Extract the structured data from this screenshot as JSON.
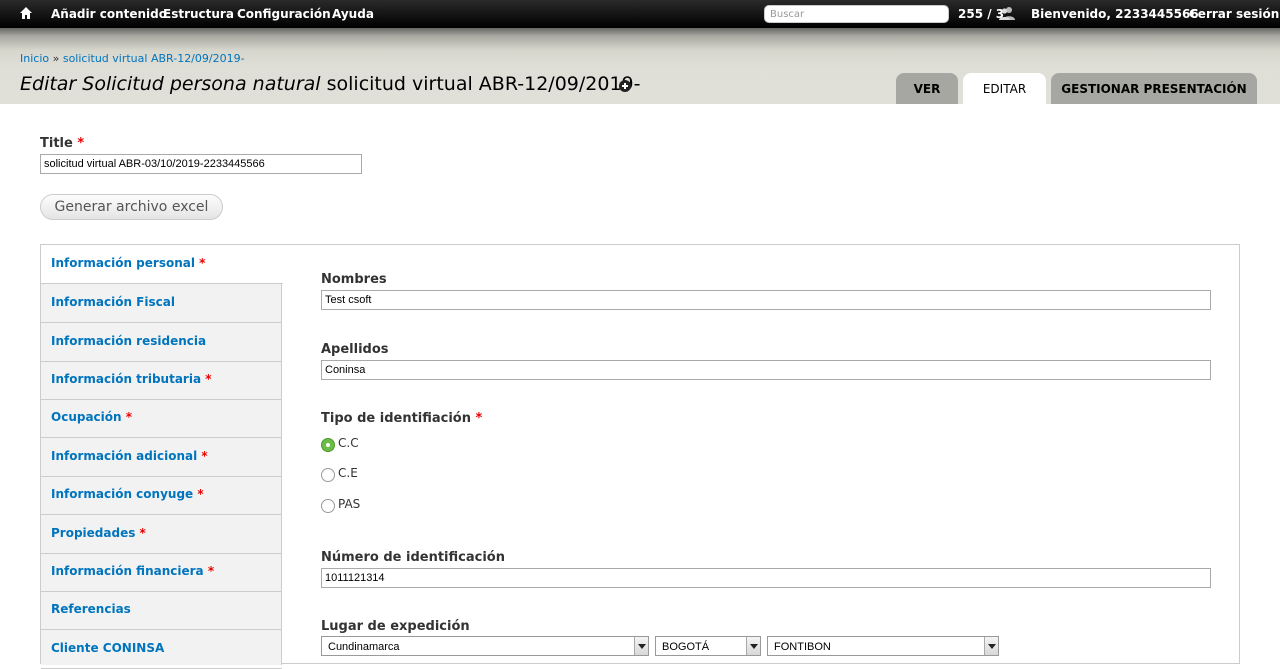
{
  "toolbar": {
    "menu": [
      "Añadir contenido",
      "Estructura",
      "Configuración",
      "Ayuda"
    ],
    "search_placeholder": "Buscar",
    "users_count": "255 / 3",
    "welcome_prefix": "Bienvenido, ",
    "username": "2233445566",
    "logout": "Cerrar sesión"
  },
  "breadcrumb": {
    "home": "Inicio",
    "separator": " » ",
    "current": "solicitud virtual ABR-12/09/2019-"
  },
  "page_title": {
    "italic": "Editar Solicitud persona natural",
    "rest": " solicitud virtual ABR-12/09/2019-"
  },
  "tabs": [
    "Ver",
    "Editar",
    "Gestionar presentación"
  ],
  "form": {
    "title_label": "Title",
    "required_mark": "*",
    "title_value": "solicitud virtual ABR-03/10/2019-2233445566",
    "excel_button": "Generar archivo excel"
  },
  "vertical_tabs": [
    {
      "label": "Información personal",
      "required": true
    },
    {
      "label": "Información Fiscal",
      "required": false
    },
    {
      "label": "Información residencia",
      "required": false
    },
    {
      "label": "Información tributaria",
      "required": true
    },
    {
      "label": "Ocupación",
      "required": true
    },
    {
      "label": "Información adicional",
      "required": true
    },
    {
      "label": "Información conyuge",
      "required": true
    },
    {
      "label": "Propiedades",
      "required": true
    },
    {
      "label": "Información financiera",
      "required": true
    },
    {
      "label": "Referencias",
      "required": false
    },
    {
      "label": "Cliente CONINSA",
      "required": false
    }
  ],
  "personal": {
    "nombres_label": "Nombres",
    "nombres_value": "Test csoft",
    "apellidos_label": "Apellidos",
    "apellidos_value": "Coninsa",
    "tipo_label": "Tipo de identifiación",
    "tipo_options": [
      "C.C",
      "C.E",
      "PAS"
    ],
    "tipo_selected": "C.C",
    "numero_label": "Número de identificación",
    "numero_value": "1011121314",
    "lugar_label": "Lugar de expedición",
    "departamento": "Cundinamarca",
    "ciudad": "BOGOTÁ",
    "localidad": "FONTIBON"
  },
  "colors": {
    "link": "#0074bd",
    "required": "#e00000",
    "radio_checked": "#6cbd45"
  }
}
